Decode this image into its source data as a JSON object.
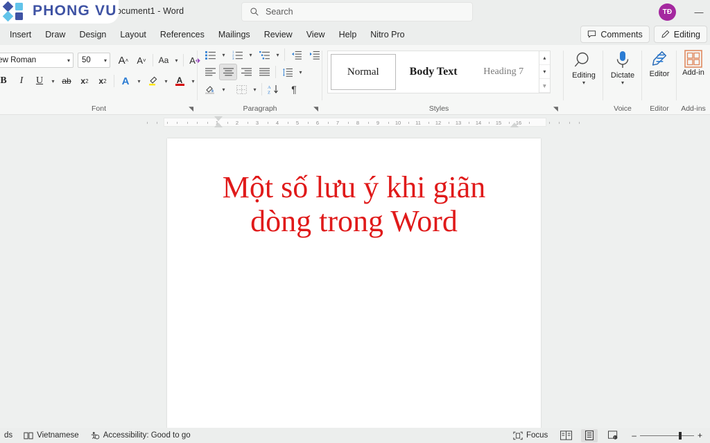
{
  "titlebar": {
    "doc_title": "ocument1  -  Word",
    "search_placeholder": "Search",
    "avatar_initials": "TĐ",
    "minimize_label": "—"
  },
  "logo": {
    "text": "PHONG VU",
    "dark_color": "#3f53a4",
    "light_color": "#62c4ea"
  },
  "tabs": [
    {
      "label": "Insert"
    },
    {
      "label": "Draw"
    },
    {
      "label": "Design"
    },
    {
      "label": "Layout"
    },
    {
      "label": "References"
    },
    {
      "label": "Mailings"
    },
    {
      "label": "Review"
    },
    {
      "label": "View"
    },
    {
      "label": "Help"
    },
    {
      "label": "Nitro Pro"
    }
  ],
  "tab_actions": {
    "comments": "Comments",
    "editing": "Editing"
  },
  "ribbon": {
    "font_group": {
      "label": "Font",
      "font_name": "mes New Roman",
      "font_size": "50",
      "grow_font": "A",
      "shrink_font": "A",
      "change_case": "Aa",
      "clear_formatting": "A",
      "bold": "B",
      "italic": "I",
      "underline": "U",
      "strikethrough": "ab",
      "subscript": "x",
      "subscript_sub": "2",
      "superscript": "x",
      "superscript_sup": "2",
      "text_effects": "A",
      "highlight": "A",
      "font_color": "A"
    },
    "paragraph_group": {
      "label": "Paragraph"
    },
    "styles_group": {
      "label": "Styles",
      "items": [
        {
          "name": "Normal",
          "active": true
        },
        {
          "name": "Body Text",
          "active": false
        },
        {
          "name": "Heading 7",
          "active": false
        }
      ]
    },
    "editing_group": {
      "label": "Editing",
      "button": "Editing"
    },
    "voice_group": {
      "label": "Voice",
      "button": "Dictate"
    },
    "editor_group": {
      "label": "Editor",
      "button": "Editor"
    },
    "addins_group": {
      "label": "Add-ins",
      "button": "Add-in"
    }
  },
  "ruler": {
    "numbers": [
      "1",
      "2",
      "3",
      "4",
      "5",
      "6",
      "7",
      "8",
      "9",
      "10",
      "11",
      "12",
      "13",
      "14",
      "15",
      "16"
    ]
  },
  "document": {
    "heading_line1": "Một số lưu ý khi giãn",
    "heading_line2": "dòng trong Word",
    "heading_color": "#e01a1a"
  },
  "statusbar": {
    "words": "ds",
    "language": "Vietnamese",
    "accessibility": "Accessibility: Good to go",
    "focus": "Focus"
  }
}
